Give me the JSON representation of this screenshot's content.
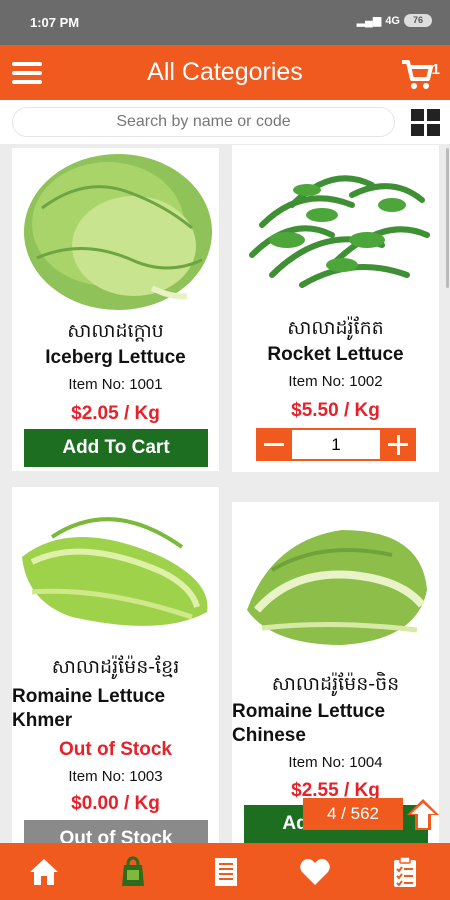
{
  "status": {
    "time": "1:07 PM",
    "network": "4G",
    "battery": "76"
  },
  "header": {
    "title": "All Categories",
    "cart_count": "1"
  },
  "search": {
    "placeholder": "Search by name or code"
  },
  "products": [
    {
      "khmer": "សាលាដក្ដោប",
      "name": "Iceberg Lettuce",
      "item_no": "Item No: 1001",
      "price": "$2.05 / Kg",
      "action": "Add To Cart"
    },
    {
      "khmer": "សាលាដរ៉ូកែត",
      "name": "Rocket Lettuce",
      "item_no": "Item No: 1002",
      "price": "$5.50 / Kg",
      "quantity": "1"
    },
    {
      "khmer": "សាលាដរ៉ូម៉ែន-ខ្មែរ",
      "name": "Romaine Lettuce Khmer",
      "stock": "Out of Stock",
      "item_no": "Item No: 1003",
      "price": "$0.00 / Kg",
      "action": "Out of Stock"
    },
    {
      "khmer": "សាលាដរ៉ូម៉ែន-ចិន",
      "name": "Romaine Lettuce Chinese",
      "item_no": "Item No: 1004",
      "price": "$2.55 / Kg",
      "action": "Add To Cart"
    }
  ],
  "pager": {
    "indicator": "4 / 562"
  },
  "nav": [
    "home-icon",
    "grocery-bag-icon",
    "receipt-icon",
    "heart-icon",
    "clipboard-icon"
  ],
  "colors": {
    "primary": "#f05a1e",
    "button_green": "#1e6e22",
    "price_red": "#e8202a",
    "disabled_gray": "#8a8a8a"
  }
}
